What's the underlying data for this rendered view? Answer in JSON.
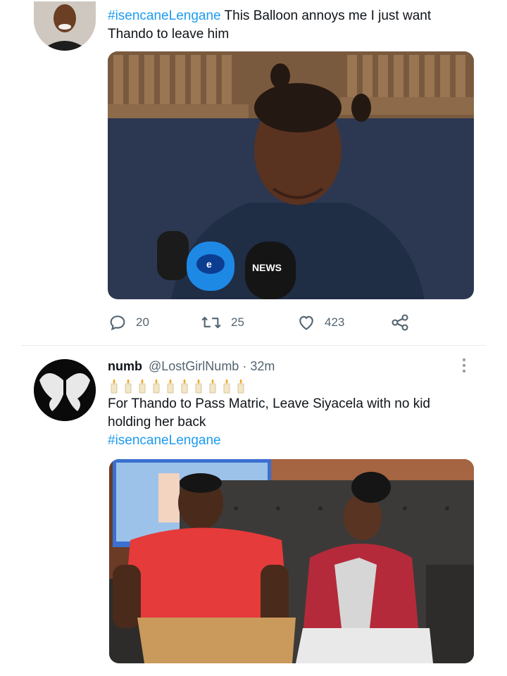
{
  "tweet1": {
    "hashtag": "#isencaneLengane",
    "text_part1": " This Balloon annoys me I just want",
    "text_part2": "Thando to leave him",
    "replies": "20",
    "retweets": "25",
    "likes": "423",
    "image_label": "NEWS"
  },
  "tweet2": {
    "display_name": "numb",
    "handle_time": "@LostGirlNumb · 32m",
    "emoji_count": 10,
    "text_line1": "For Thando to Pass Matric, Leave Siyacela with no kid",
    "text_line2": "holding her back",
    "hashtag": "#isencaneLengane"
  },
  "colors": {
    "accent": "#1d9bf0",
    "muted": "#536471",
    "divider": "#eff3f4"
  },
  "icons": [
    "reply-icon",
    "retweet-icon",
    "like-icon",
    "share-icon",
    "more-icon"
  ]
}
